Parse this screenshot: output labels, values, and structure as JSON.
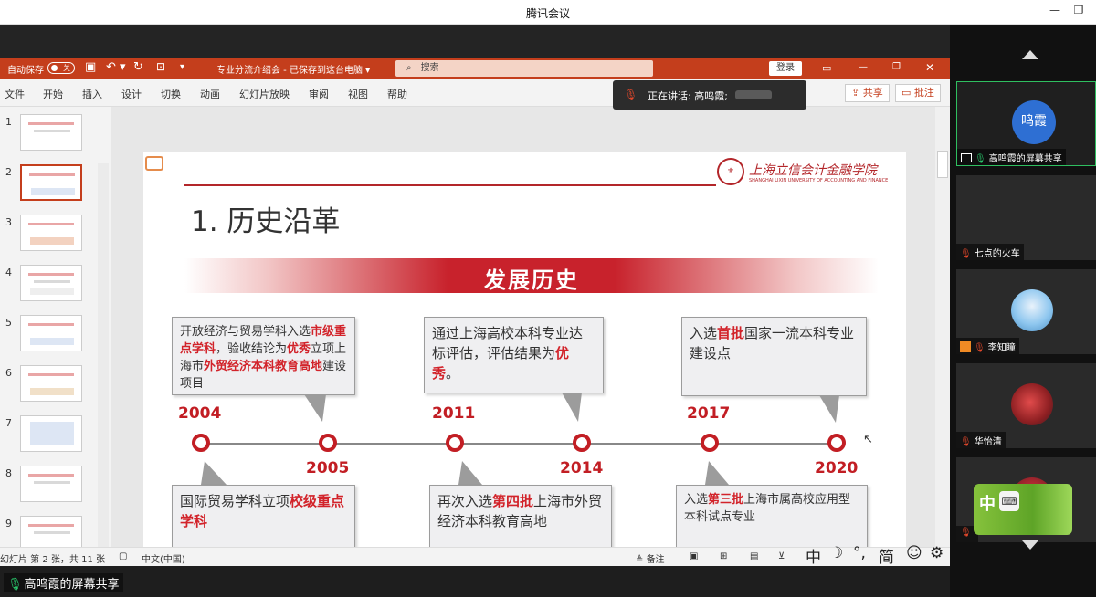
{
  "meeting": {
    "title": "腾讯会议",
    "minimize_icon": "minimize-icon",
    "restore_icon": "restore-icon"
  },
  "ppt": {
    "autosave_label": "自动保存",
    "autosave_state": "关",
    "doc_title": "专业分流介绍会 - 已保存到这台电脑 ▾",
    "search_placeholder": "搜索",
    "login_label": "登录",
    "menu": [
      "文件",
      "开始",
      "插入",
      "设计",
      "切换",
      "动画",
      "幻灯片放映",
      "审阅",
      "视图",
      "帮助"
    ],
    "share_label": "共享",
    "comment_label": "批注",
    "accent": "#c43e1c"
  },
  "speaking": {
    "text": "正在讲话: 高鸣霞;"
  },
  "thumbnails": [
    "1",
    "2",
    "3",
    "4",
    "5",
    "6",
    "7",
    "8",
    "9"
  ],
  "slide": {
    "title": "1. 历史沿革",
    "logo_text": "上海立信会计金融学院",
    "logo_sub": "SHANGHAI LIXIN UNIVERSITY OF ACCOUNTING AND FINANCE",
    "banner": "发展历史",
    "years": {
      "y2004": "2004",
      "y2005": "2005",
      "y2011": "2011",
      "y2014": "2014",
      "y2017": "2017",
      "y2020": "2020"
    },
    "box2004": {
      "p1": "开放经济与贸易学科入选",
      "r1": "市级重点学科",
      "p2": "，验收结论为",
      "r2": "优秀",
      "p3": "立项上海市",
      "r3": "外贸经济本科教育高地",
      "p4": "建设项目"
    },
    "box2011": {
      "p1": "通过上海高校本科专业达标评估，评估结果为",
      "r1": "优秀",
      "p2": "。"
    },
    "box2017": {
      "p1": "入选",
      "r1": "首批",
      "p2": "国家一流本科专业建设点"
    },
    "box2005": {
      "p1": "国际贸易学科立项",
      "r1": "校级重点学科"
    },
    "box2014": {
      "p1": "再次入选",
      "r1": "第四批",
      "p2": "上海市外贸经济本科教育高地"
    },
    "box2020": {
      "p1": "入选",
      "r1": "第三批",
      "p2": "上海市属高校应用型本科试点专业"
    }
  },
  "status": {
    "slide_info": "幻灯片 第 2 张，共 11 张",
    "language": "中文(中国)",
    "notes_label": "备注"
  },
  "ime": {
    "items": [
      "中",
      "☽",
      "°,",
      "简",
      "☺",
      "⚙"
    ],
    "float_label": "中"
  },
  "share_label": "高鸣霞的屏幕共享",
  "participants": [
    {
      "name": "高鸣霞的屏幕共享",
      "avatar_text": "鸣霞"
    },
    {
      "name": "七点的火车"
    },
    {
      "name": "李知瞳"
    },
    {
      "name": "华怡清"
    },
    {
      "name": ""
    }
  ]
}
